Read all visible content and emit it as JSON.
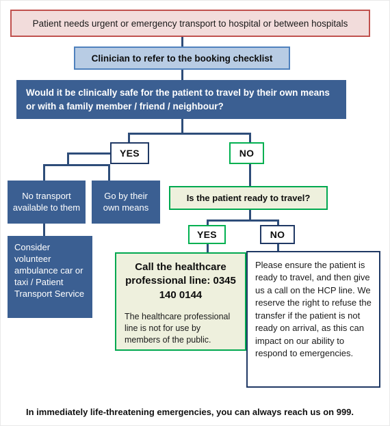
{
  "diagram": {
    "title_box": {
      "text": "Patient needs urgent or emergency transport to hospital or between hospitals",
      "fill": "#f2dcdb",
      "border": "#c0504d"
    },
    "checklist_box": {
      "text": "Clinician to refer to the booking checklist",
      "fill": "#b8cce4",
      "border": "#4f81bd"
    },
    "main_question": {
      "text": "Would it be clinically safe for the patient to travel by their own means or with a family member / friend / neighbour?",
      "fill": "#3b5f92"
    },
    "branch_yes_label": "YES",
    "branch_no_label": "NO",
    "outcome_no_transport": "No transport available to them",
    "outcome_own_means": "Go by their own means",
    "outcome_consider": "Consider volunteer ambulance car or taxi / Patient Transport Service",
    "ready_question": {
      "text": "Is the patient ready to travel?",
      "fill": "#eef0dd",
      "border": "#00a84f"
    },
    "ready_yes_label": "YES",
    "ready_no_label": "NO",
    "hcp_callout": {
      "heading": "Call the healthcare professional line: 0345 140 0144",
      "subtext": "The healthcare professional line is not for use by members of the public.",
      "fill": "#eef0dd",
      "border": "#00a84f"
    },
    "not_ready_note": {
      "text": "Please ensure the patient is ready to travel, and then give us a call on the HCP line. We reserve the right to refuse the transfer if the patient is not ready on arrival, as this can impact on our ability to respond to emergencies.",
      "border": "#1f3864"
    },
    "footer": "In immediately life-threatening emergencies, you can always reach us on 999.",
    "connector_color": "#2e4d79"
  }
}
